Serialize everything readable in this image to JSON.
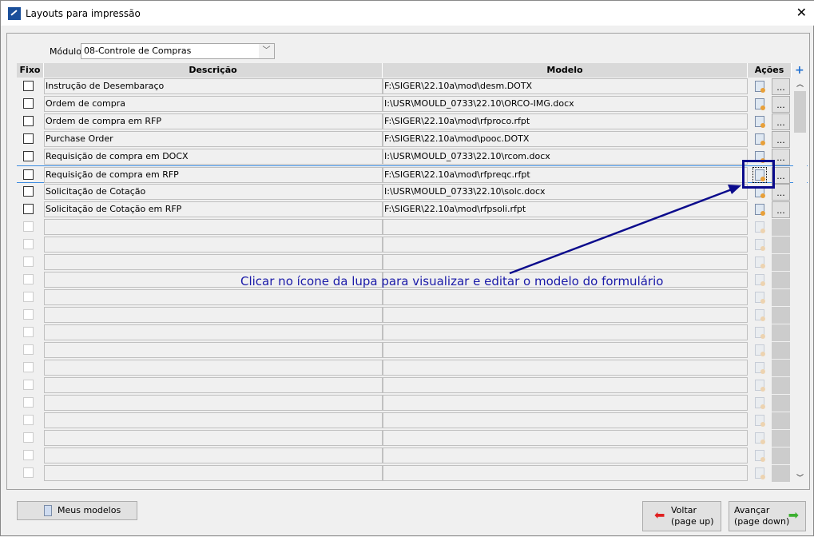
{
  "window": {
    "title": "Layouts para impressão",
    "close": "✕"
  },
  "module": {
    "label": "Módulo",
    "value": "08-Controle de Compras"
  },
  "columns": {
    "fixo": "Fixo",
    "descricao": "Descrição",
    "modelo": "Modelo",
    "acoes": "Ações",
    "add": "+"
  },
  "rows": [
    {
      "descricao": "Instrução de Desembaraço",
      "modelo": "F:\\SIGER\\22.10a\\mod\\desm.DOTX"
    },
    {
      "descricao": "Ordem de compra",
      "modelo": "I:\\USR\\MOULD_0733\\22.10\\ORCO-IMG.docx"
    },
    {
      "descricao": "Ordem de compra em RFP",
      "modelo": "F:\\SIGER\\22.10a\\mod\\rfproco.rfpt"
    },
    {
      "descricao": "Purchase Order",
      "modelo": "F:\\SIGER\\22.10a\\mod\\pooc.DOTX"
    },
    {
      "descricao": "Requisição de compra em DOCX",
      "modelo": "I:\\USR\\MOULD_0733\\22.10\\rcom.docx"
    },
    {
      "descricao": "Requisição de compra em RFP",
      "modelo": "F:\\SIGER\\22.10a\\mod\\rfpreqc.rfpt"
    },
    {
      "descricao": "Solicitação de Cotação",
      "modelo": "I:\\USR\\MOULD_0733\\22.10\\solc.docx"
    },
    {
      "descricao": "Solicitação de Cotação em RFP",
      "modelo": "F:\\SIGER\\22.10a\\mod\\rfpsoli.rfpt"
    }
  ],
  "dots_label": "...",
  "annotation": "Clicar no ícone da lupa para visualizar e editar o modelo do formulário",
  "buttons": {
    "meus_modelos": "Meus modelos",
    "voltar": "Voltar",
    "voltar_sub": "(page up)",
    "avancar": "Avançar",
    "avancar_sub": "(page down)"
  },
  "colors": {
    "annotation": "#1a1aa8",
    "highlight": "#0b0b8c"
  }
}
